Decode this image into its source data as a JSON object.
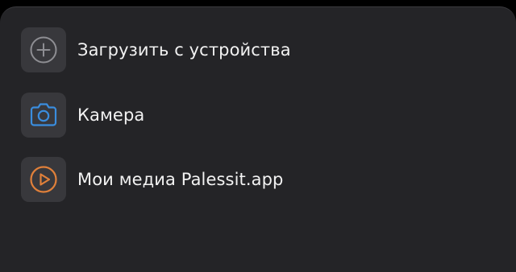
{
  "menu": {
    "items": [
      {
        "label": "Загрузить с устройства",
        "icon": "plus-circle-icon",
        "icon_color": "#8e8e93"
      },
      {
        "label": "Камера",
        "icon": "camera-icon",
        "icon_color": "#3a8dde"
      },
      {
        "label": "Мои медиа Palessit.app",
        "icon": "play-circle-icon",
        "icon_color": "#e0803a"
      }
    ]
  }
}
